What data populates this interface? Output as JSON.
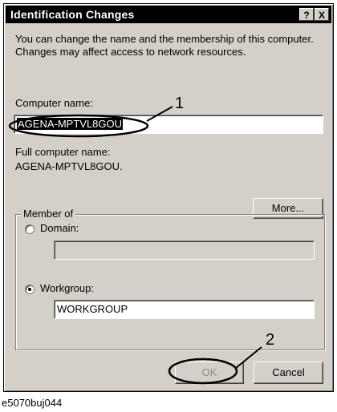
{
  "dialog": {
    "title": "Identification Changes",
    "help_glyph": "?",
    "close_glyph": "X",
    "intro": "You can change the name and the membership of this computer. Changes may affect access to network resources.",
    "computer_name_label": "Computer name:",
    "computer_name_value": "AGENA-MPTVL8GOU",
    "full_name_label": "Full computer name:",
    "full_name_value": "AGENA-MPTVL8GOU.",
    "more_button": "More...",
    "member_of": {
      "title": "Member of",
      "domain_label": "Domain:",
      "domain_value": "",
      "domain_selected": false,
      "workgroup_label": "Workgroup:",
      "workgroup_value": "WORKGROUP",
      "workgroup_selected": true
    },
    "ok_button": "OK",
    "cancel_button": "Cancel"
  },
  "callouts": [
    "1",
    "2"
  ],
  "caption": "e5070buj044",
  "colors": {
    "face": "#d4d0c8",
    "titlebar": "#000000",
    "annotation": "#000000"
  }
}
